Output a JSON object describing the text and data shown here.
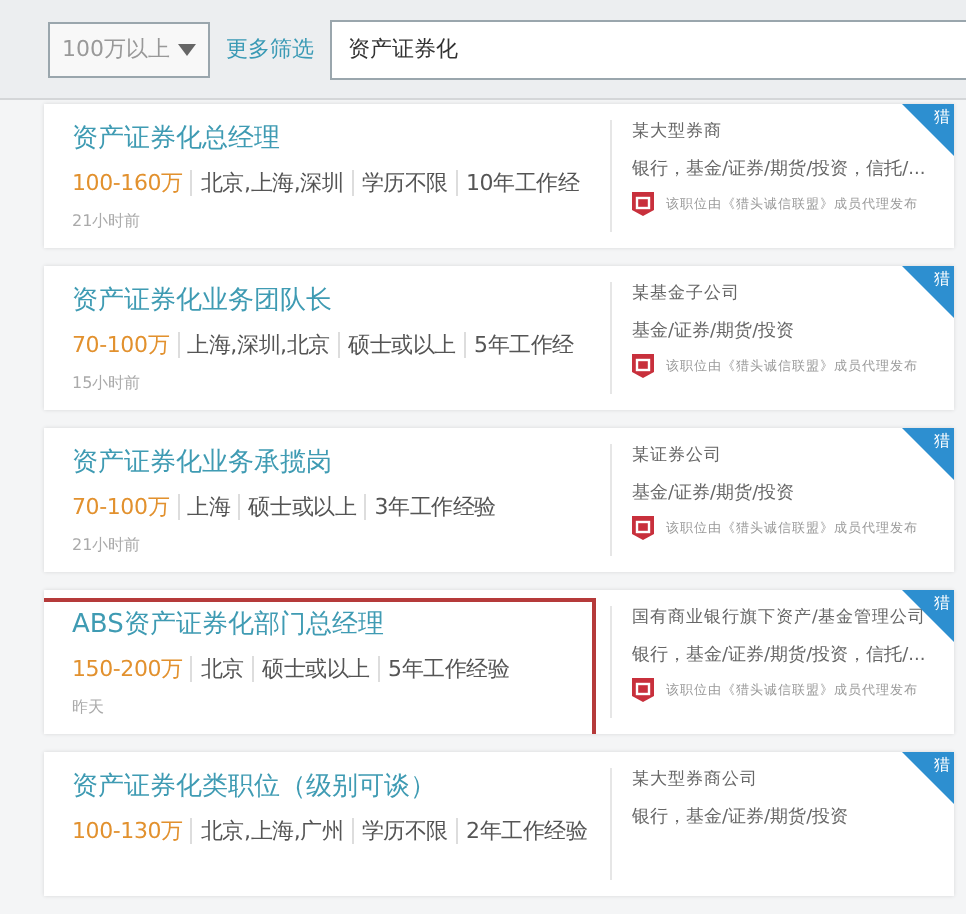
{
  "filter_bar": {
    "salary_select": "100万以上",
    "more_filters": "更多筛选",
    "search": {
      "value": "资产证券化"
    }
  },
  "jobs": [
    {
      "title": "资产证券化总经理",
      "salary": "100-160万",
      "meta": [
        "北京,上海,深圳",
        "学历不限",
        "10年工作经"
      ],
      "posted": "21小时前",
      "company": "某大型券商",
      "industry": "银行，基金/证券/期货/投资，信托/...",
      "note": "该职位由《猎头诚信联盟》成员代理发布",
      "badge": "猎",
      "highlighted": false
    },
    {
      "title": "资产证券化业务团队长",
      "salary": "70-100万",
      "meta": [
        "上海,深圳,北京",
        "硕士或以上",
        "5年工作经"
      ],
      "posted": "15小时前",
      "company": "某基金子公司",
      "industry": "基金/证券/期货/投资",
      "note": "该职位由《猎头诚信联盟》成员代理发布",
      "badge": "猎",
      "highlighted": false
    },
    {
      "title": "资产证券化业务承揽岗",
      "salary": "70-100万",
      "meta": [
        "上海",
        "硕士或以上",
        "3年工作经验"
      ],
      "posted": "21小时前",
      "company": "某证券公司",
      "industry": "基金/证券/期货/投资",
      "note": "该职位由《猎头诚信联盟》成员代理发布",
      "badge": "猎",
      "highlighted": false
    },
    {
      "title": "ABS资产证券化部门总经理",
      "salary": "150-200万",
      "meta": [
        "北京",
        "硕士或以上",
        "5年工作经验"
      ],
      "posted": "昨天",
      "company": "国有商业银行旗下资产/基金管理公司",
      "industry": "银行，基金/证券/期货/投资，信托/...",
      "note": "该职位由《猎头诚信联盟》成员代理发布",
      "badge": "猎",
      "highlighted": true
    },
    {
      "title": "资产证券化类职位（级别可谈）",
      "salary": "100-130万",
      "meta": [
        "北京,上海,广州",
        "学历不限",
        "2年工作经验"
      ],
      "company": "某大型券商公司",
      "industry": "银行，基金/证券/期货/投资",
      "badge": "猎",
      "highlighted": false
    }
  ]
}
